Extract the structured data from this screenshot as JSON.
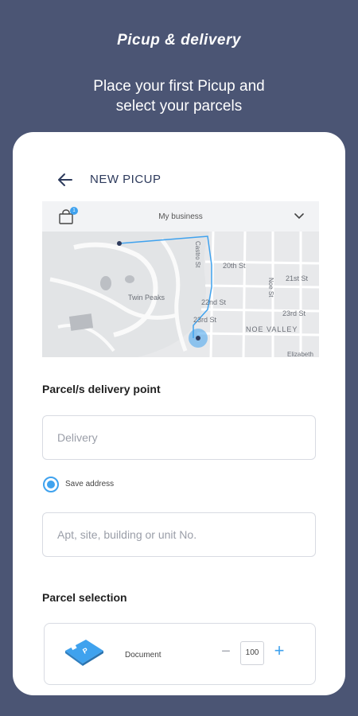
{
  "hero": {
    "title": "Picup & delivery",
    "subtitle_line1": "Place your first Picup and",
    "subtitle_line2": "select your parcels"
  },
  "topbar": {
    "title": "NEW PICUP",
    "back_icon": "arrow-left-icon"
  },
  "business": {
    "label": "My business",
    "badge": "1"
  },
  "map": {
    "labels": {
      "castro": "Castro St",
      "s20": "20th St",
      "s21": "21st St",
      "s22": "22nd St",
      "s23": "23rd St",
      "s23b": "23rd St",
      "noe": "Noe St",
      "twin": "Twin Peaks",
      "valley": "NOE VALLEY",
      "elizabeth": "Elizabeth"
    }
  },
  "delivery_section": {
    "title": "Parcel/s delivery point",
    "delivery_placeholder": "Delivery",
    "save_address_label": "Save address",
    "unit_placeholder": "Apt, site, building or unit No."
  },
  "parcel_section": {
    "title": "Parcel selection",
    "item_label": "Document",
    "quantity": "100"
  },
  "colors": {
    "background": "#4b5574",
    "accent": "#3fa2ee",
    "card": "#ffffff"
  }
}
